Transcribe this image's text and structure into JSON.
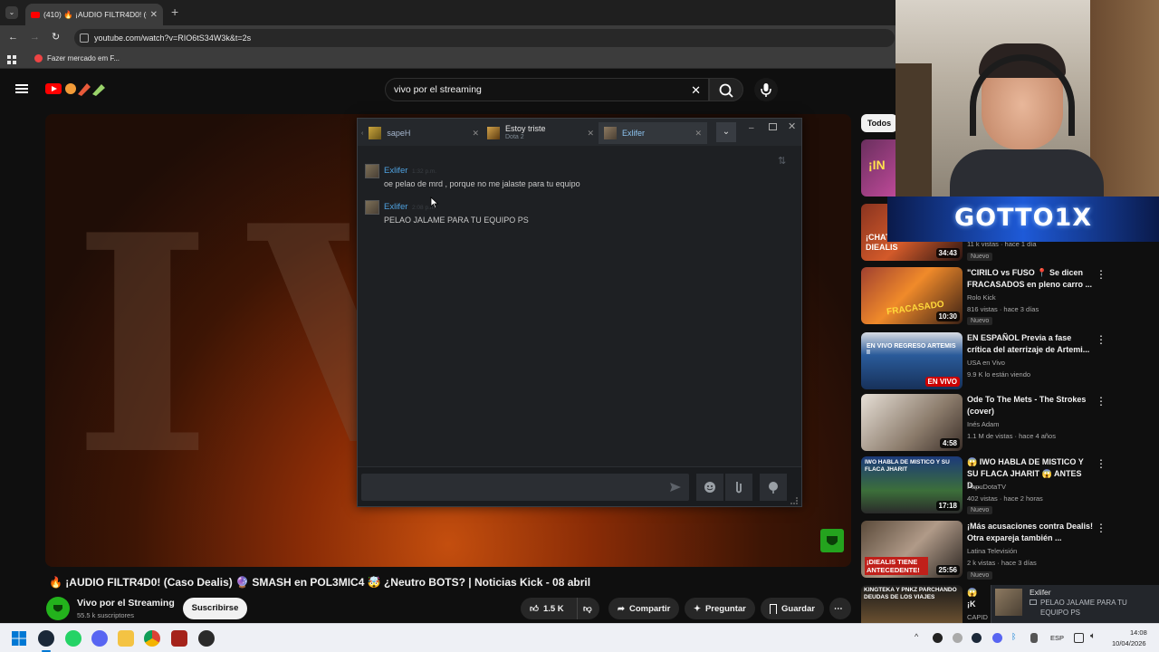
{
  "browser": {
    "tab_title": "(410) 🔥 ¡AUDIO FILTR4D0! (Ca",
    "url": "youtube.com/watch?v=RIO6tS34W3k&t=2s",
    "bookmark_label": "Fazer mercado em F..."
  },
  "youtube": {
    "search_query": "vivo por el streaming",
    "video_title": "🔥 ¡AUDIO FILTR4D0! (Caso Dealis) 🔮 SMASH en POL3MIC4 🤯 ¿Neutro BOTS? | Noticias Kick - 08 abril",
    "channel_name": "Vivo por el Streaming",
    "subscribers": "55.5 k suscriptores",
    "subscribe_label": "Suscribirse",
    "likes": "1.5 K",
    "share_label": "Compartir",
    "ask_label": "Preguntar",
    "save_label": "Guardar",
    "filter_chip": "Todos"
  },
  "chat_window": {
    "tabs": [
      {
        "name": "sapeH"
      },
      {
        "name": "Estoy triste",
        "status": "Dota 2"
      },
      {
        "name": "Exlifer"
      }
    ],
    "messages": [
      {
        "author": "Exlifer",
        "time": "1:32 p.m.",
        "text": "oe pelao de mrd , porque no me jalaste para tu equipo"
      },
      {
        "author": "Exlifer",
        "time": "2:08 p.m.",
        "text": "PELAO JALAME PARA TU EQUIPO PS"
      }
    ]
  },
  "webcam": {
    "overlay_text": "GOTTO1X"
  },
  "recommendations": [
    {
      "thumb_text": "¡IN",
      "meta": "",
      "title": "",
      "new": ""
    },
    {
      "thumb_text": "¡CHATS DELA A DIEALIS",
      "duration": "34:43",
      "meta": "11 k vistas · hace 1 día",
      "new": "Nuevo"
    },
    {
      "thumb_text": "FRACASADO",
      "duration": "10:30",
      "title": "\"CIRILO vs FUSO 📍 Se dicen FRACASADOS en pleno carro ...",
      "channel": "Rolo Kick",
      "meta": "816 vistas · hace 3 días",
      "new": "Nuevo"
    },
    {
      "thumb_text": "EN VIVO REGRESO ARTEMIS II",
      "duration": "EN VIVO",
      "title": "EN ESPAÑOL Previa a fase crítica del aterrizaje de Artemi...",
      "channel": "USA en Vivo",
      "meta": "9.9 K lo están viendo",
      "new": ""
    },
    {
      "thumb_text": "",
      "duration": "4:58",
      "title": "Ode To The Mets - The Strokes (cover)",
      "channel": "Inés Adam",
      "meta": "1.1 M de vistas · hace 4 años",
      "new": ""
    },
    {
      "thumb_text": "IWO HABLA DE MISTICO Y SU FLACA JHARIT",
      "duration": "17:18",
      "title": "😱 IWO HABLA DE MISTICO Y SU FLACA JHARIT 😱 ANTES D...",
      "channel": "PapuDotaTV",
      "meta": "402 vistas · hace 2 horas",
      "new": "Nuevo"
    },
    {
      "thumb_text": "¡DIEALIS TIENE ANTECEDENTE!",
      "duration": "25:56",
      "title": "¡Más acusaciones contra Dealis! Otra expareja también ...",
      "channel": "Latina Televisión",
      "meta": "2 k vistas · hace 3 días",
      "new": "Nuevo"
    },
    {
      "thumb_text": "KINGTEKA Y PNKZ PARCHANDO DEUDAS DE LOS VIAJES",
      "title": "😱 ¡K PARC",
      "channel": "CAPID",
      "meta": "",
      "new": ""
    }
  ],
  "notification": {
    "author": "Exlifer",
    "text": "PELAO JALAME PARA TU EQUIPO PS"
  },
  "taskbar": {
    "language": "ESP",
    "time": "14:08",
    "date": "10/04/2026"
  },
  "colors": {
    "accent_red": "#ff0000",
    "steam_blue": "#4fa2e0"
  }
}
